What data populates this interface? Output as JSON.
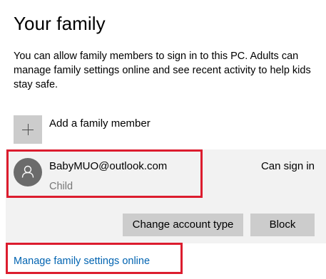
{
  "page": {
    "title": "Your family",
    "description": "You can allow family members to sign in to this PC. Adults can manage family settings online and see recent activity to help kids stay safe."
  },
  "add_member": {
    "icon": "plus-icon",
    "label": "Add a family member"
  },
  "member": {
    "avatar_icon": "person-icon",
    "email": "BabyMUO@outlook.com",
    "role": "Child",
    "status": "Can sign in"
  },
  "actions": {
    "change_account_type_label": "Change account type",
    "block_label": "Block"
  },
  "links": {
    "manage_online_label": "Manage family settings online"
  },
  "colors": {
    "link": "#0063b1",
    "highlight": "#dc1c2e",
    "button_bg": "#cccccc",
    "panel_bg": "#f2f2f2",
    "avatar_bg": "#6b6b6b",
    "secondary_text": "#767676"
  }
}
